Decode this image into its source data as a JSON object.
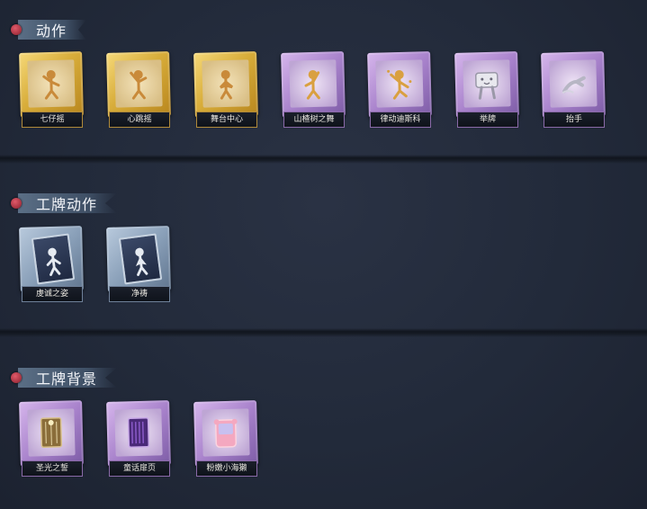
{
  "sections": [
    {
      "title": "动作",
      "items": [
        {
          "label": "七仔摇",
          "rarity": "gold",
          "icon": "dancing-figure-icon"
        },
        {
          "label": "心跳摇",
          "rarity": "gold",
          "icon": "dancing-figure-icon"
        },
        {
          "label": "舞台中心",
          "rarity": "gold",
          "icon": "posing-figure-icon"
        },
        {
          "label": "山楂树之舞",
          "rarity": "purple",
          "icon": "dancing-figure-icon"
        },
        {
          "label": "律动迪斯科",
          "rarity": "purple",
          "icon": "dancing-figure-icon"
        },
        {
          "label": "举牌",
          "rarity": "purple",
          "icon": "sign-holding-icon"
        },
        {
          "label": "抬手",
          "rarity": "purple",
          "icon": "hand-raise-icon"
        }
      ]
    },
    {
      "title": "工牌动作",
      "items": [
        {
          "label": "虔诚之姿",
          "rarity": "blue",
          "icon": "badge-pose-icon"
        },
        {
          "label": "净祷",
          "rarity": "blue",
          "icon": "badge-pose-icon"
        }
      ]
    },
    {
      "title": "工牌背景",
      "items": [
        {
          "label": "圣光之誓",
          "rarity": "purple",
          "icon": "badge-background-icon"
        },
        {
          "label": "童话扉页",
          "rarity": "purple",
          "icon": "badge-background-icon"
        },
        {
          "label": "粉嫩小海獭",
          "rarity": "purple",
          "icon": "badge-background-icon"
        }
      ]
    }
  ]
}
